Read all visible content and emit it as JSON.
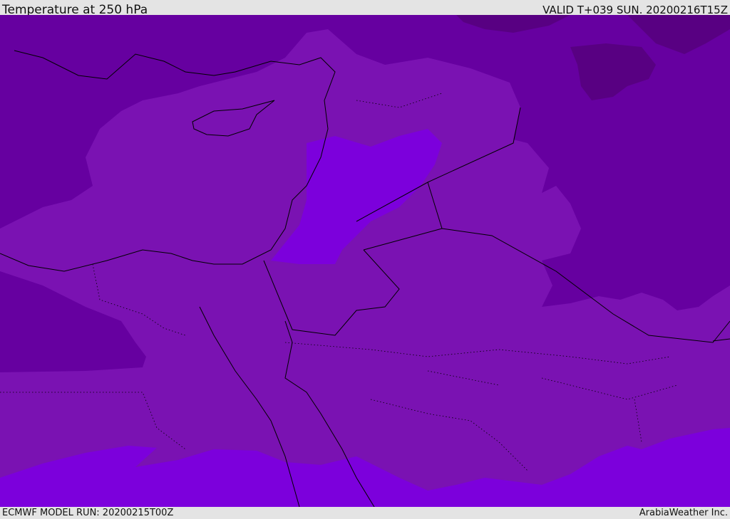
{
  "header": {
    "title": "Temperature at 250 hPa",
    "valid": "VALID T+039 SUN. 20200216T15Z"
  },
  "footer": {
    "model_run": "ECMWF MODEL RUN: 20200215T00Z",
    "brand": "ArabiaWeather Inc."
  },
  "colors": {
    "darkest": "#580082",
    "dark": "#6600a0",
    "mid": "#7a12b2",
    "bright": "#7c00dc",
    "line": "#000000"
  }
}
